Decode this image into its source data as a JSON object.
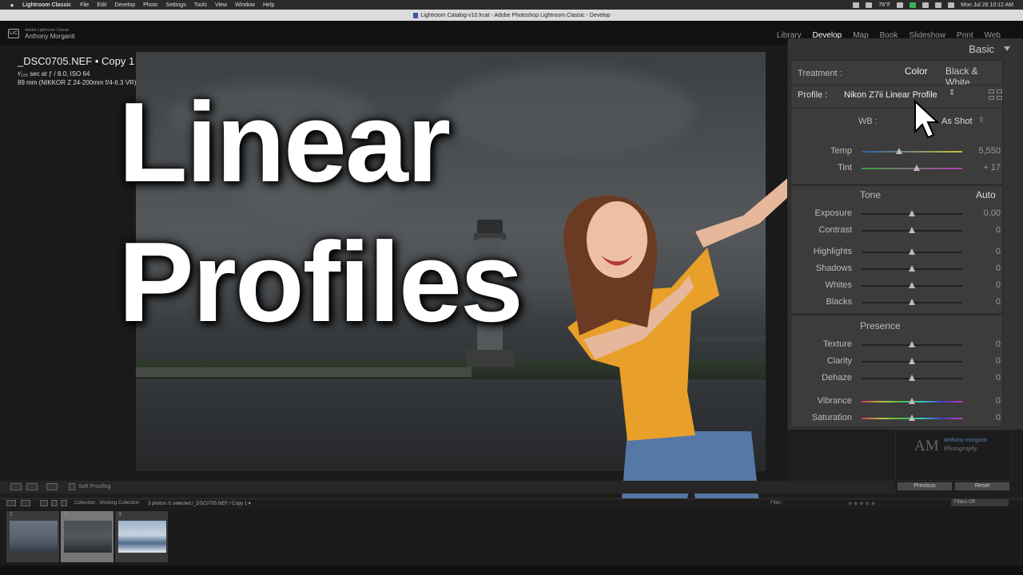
{
  "menubar": {
    "app_name": "Lightroom Classic",
    "items": [
      "File",
      "Edit",
      "Develop",
      "Photo",
      "Settings",
      "Tools",
      "View",
      "Window",
      "Help"
    ],
    "weather": "76°F",
    "clock": "Mon Jul 26  10:12 AM"
  },
  "window": {
    "title": "Lightroom Catalog-v10.lrcat - Adobe Photoshop Lightroom Classic - Develop"
  },
  "identity": {
    "logo": "LrC",
    "product": "Adobe Lightroom Classic",
    "user": "Anthony Morganti"
  },
  "modules": [
    "Library",
    "Develop",
    "Map",
    "Book",
    "Slideshow",
    "Print",
    "Web"
  ],
  "photo_info": {
    "filename": "_DSC0705.NEF  •  Copy 1",
    "exposure": "¹⁄₁₂₅ sec at ƒ / 8.0, ISO 64",
    "lens": "89 mm (NIKKOR Z 24-200mm f/4-6.3 VR)"
  },
  "overlay": {
    "line1": "Linear",
    "line2": "Profiles"
  },
  "panel": {
    "title": "Basic",
    "treatment_label": "Treatment :",
    "treatment_color": "Color",
    "treatment_bw": "Black & White",
    "profile_label": "Profile :",
    "profile_value": "Nikon Z7ii Linear Profile",
    "wb_label": "WB :",
    "wb_value": "As Shot",
    "wb_sliders": [
      {
        "label": "Temp",
        "value": "5,550",
        "position": 0.37,
        "style": "temp"
      },
      {
        "label": "Tint",
        "value": "+ 17",
        "position": 0.55,
        "style": "tint"
      }
    ],
    "tone_head": "Tone",
    "tone_auto": "Auto",
    "tone_sliders": [
      {
        "label": "Exposure",
        "value": "0.00",
        "position": 0.5
      },
      {
        "label": "Contrast",
        "value": "0",
        "position": 0.5
      }
    ],
    "tone_sliders2": [
      {
        "label": "Highlights",
        "value": "0",
        "position": 0.5
      },
      {
        "label": "Shadows",
        "value": "0",
        "position": 0.5
      },
      {
        "label": "Whites",
        "value": "0",
        "position": 0.5
      },
      {
        "label": "Blacks",
        "value": "0",
        "position": 0.5
      }
    ],
    "presence_head": "Presence",
    "presence_sliders": [
      {
        "label": "Texture",
        "value": "0",
        "position": 0.5
      },
      {
        "label": "Clarity",
        "value": "0",
        "position": 0.5
      },
      {
        "label": "Dehaze",
        "value": "0",
        "position": 0.5
      }
    ],
    "presence_sliders2": [
      {
        "label": "Vibrance",
        "value": "0",
        "position": 0.5,
        "style": "sat"
      },
      {
        "label": "Saturation",
        "value": "0",
        "position": 0.5,
        "style": "sat"
      }
    ]
  },
  "brand": {
    "initials": "AM",
    "name": "anthony morganti",
    "sub": "Photography"
  },
  "buttons": {
    "previous": "Previous",
    "reset": "Reset"
  },
  "toolbar": {
    "soft_proofing": "Soft Proofing"
  },
  "filmstrip": {
    "path": "Collection : Working Collection",
    "count": "3 photos /1 selected /_DSC0705.NEF / Copy 1 ▾",
    "filter_label": "Filter :",
    "filters_off": "Filters Off",
    "cells": [
      {
        "num": "1"
      },
      {
        "num": "2"
      },
      {
        "num": "3"
      }
    ]
  },
  "colors": {
    "accent_blue": "#5f7fa8",
    "panel_bg": "#333333",
    "title_white": "#ffffff"
  }
}
